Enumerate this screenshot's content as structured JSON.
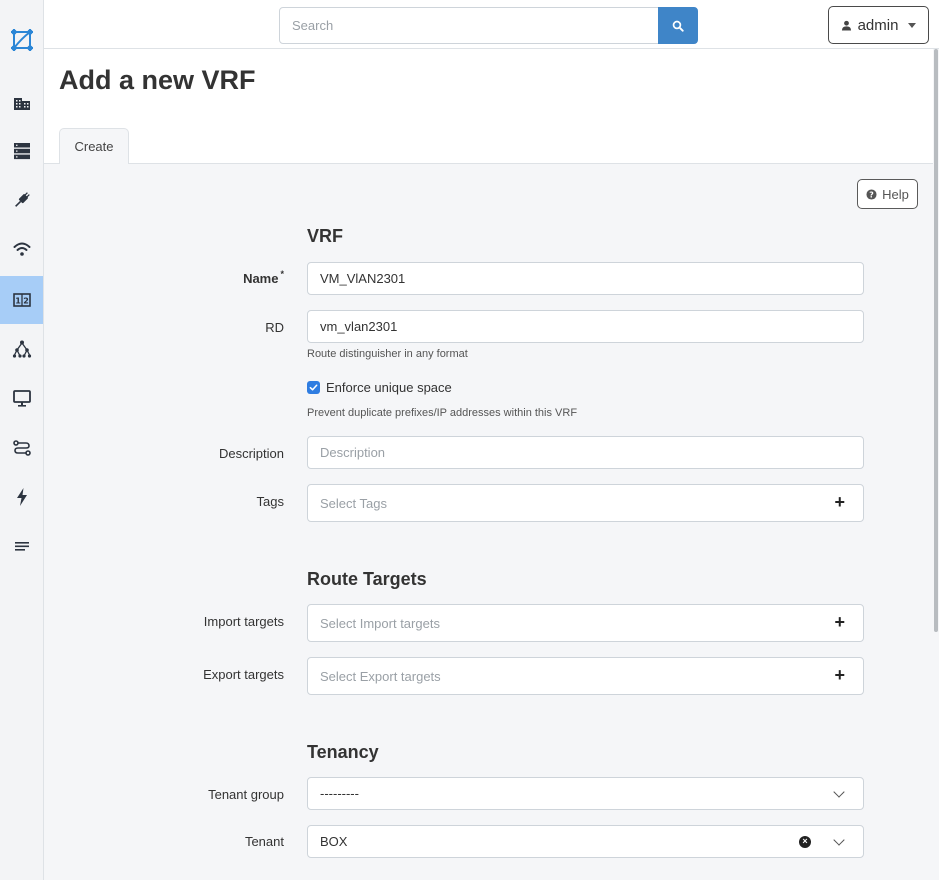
{
  "header": {
    "search_placeholder": "Search",
    "user_label": "admin"
  },
  "page": {
    "title": "Add a new VRF",
    "tab_label": "Create"
  },
  "help_button": "Help",
  "sidebar": {
    "items": [
      {
        "icon": "buildings-icon"
      },
      {
        "icon": "server-rack-icon"
      },
      {
        "icon": "plug-icon"
      },
      {
        "icon": "wifi-icon"
      },
      {
        "icon": "ip-address-icon",
        "active": true
      },
      {
        "icon": "network-tree-icon"
      },
      {
        "icon": "monitor-icon"
      },
      {
        "icon": "circuit-icon"
      },
      {
        "icon": "lightning-icon"
      },
      {
        "icon": "menu-lines-icon"
      }
    ]
  },
  "form": {
    "vrf_section": {
      "title": "VRF",
      "name_label": "Name",
      "name_required_mark": "*",
      "name_value": "VM_VlAN2301",
      "rd_label": "RD",
      "rd_value": "vm_vlan2301",
      "rd_help": "Route distinguisher in any format",
      "enforce_label": "Enforce unique space",
      "enforce_checked": true,
      "enforce_help": "Prevent duplicate prefixes/IP addresses within this VRF",
      "description_label": "Description",
      "description_placeholder": "Description",
      "tags_label": "Tags",
      "tags_placeholder": "Select Tags"
    },
    "route_targets_section": {
      "title": "Route Targets",
      "import_label": "Import targets",
      "import_placeholder": "Select Import targets",
      "export_label": "Export targets",
      "export_placeholder": "Select Export targets"
    },
    "tenancy_section": {
      "title": "Tenancy",
      "tenant_group_label": "Tenant group",
      "tenant_group_value": "---------",
      "tenant_label": "Tenant",
      "tenant_value": "BOX"
    }
  },
  "colors": {
    "accent": "#3f85c8",
    "sidebar_active": "#a7cdf7",
    "checkbox": "#2f7de1"
  }
}
